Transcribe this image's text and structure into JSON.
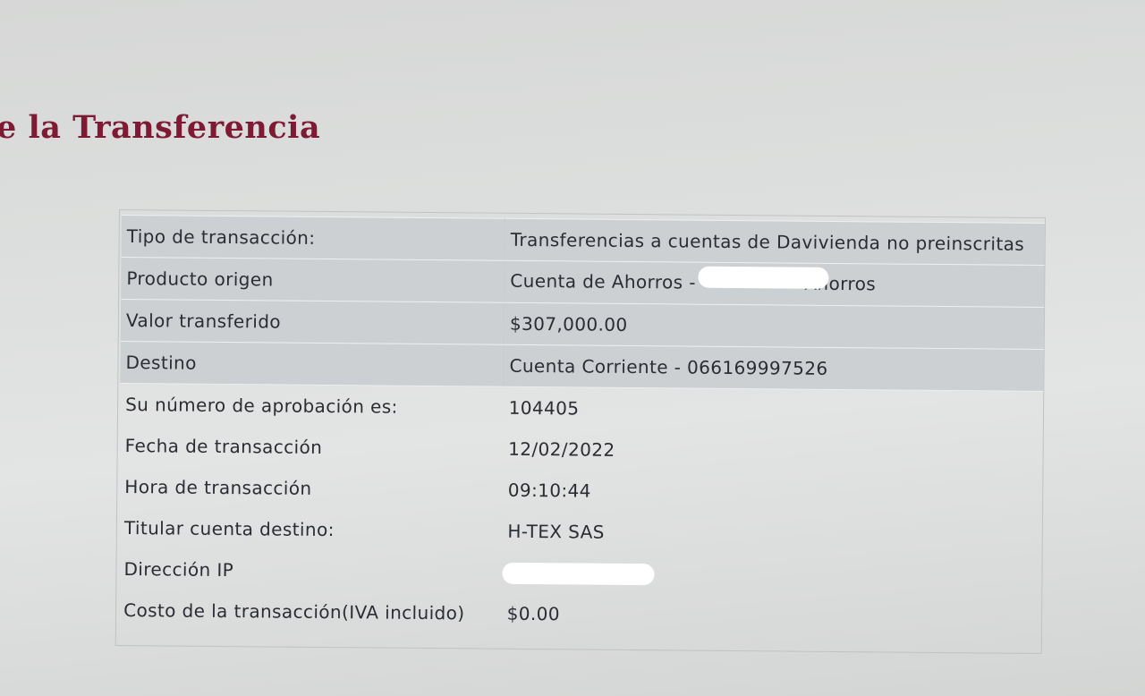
{
  "page": {
    "title": "e la Transferencia"
  },
  "details": {
    "rows": [
      {
        "label": "Tipo de transacción:",
        "value": "Transferencias a cuentas de Davivienda no preinscritas"
      },
      {
        "label": "Producto origen",
        "value_prefix": "Cuenta de Ahorros -",
        "value_suffix": "Ahorros"
      },
      {
        "label": "Valor transferido",
        "value": "$307,000.00"
      },
      {
        "label": "Destino",
        "value": "Cuenta Corriente - 066169997526"
      },
      {
        "label": "Su número de aprobación es:",
        "value": "104405"
      },
      {
        "label": "Fecha de transacción",
        "value": "12/02/2022"
      },
      {
        "label": "Hora de transacción",
        "value": "09:10:44"
      },
      {
        "label": "Titular cuenta destino:",
        "value": "H-TEX SAS"
      },
      {
        "label": "Dirección IP",
        "value": ""
      },
      {
        "label": "Costo de la transacción(IVA incluido)",
        "value": "$0.00"
      }
    ]
  }
}
